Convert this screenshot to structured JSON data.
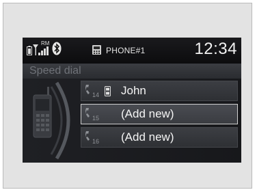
{
  "status_bar": {
    "icons": [
      "battery-icon",
      "signal-strength-icon",
      "roaming-indicator",
      "bluetooth-icon",
      "phone-icon"
    ],
    "roaming_label": "RM",
    "phone_label": "PHONE#1",
    "clock": "12:34"
  },
  "screen": {
    "title": "Speed dial"
  },
  "speed_dial": {
    "entries": [
      {
        "slot": "14",
        "label": "John",
        "icon": "mobile-phone-icon",
        "selected": false
      },
      {
        "slot": "15",
        "label": "(Add new)",
        "selected": true
      },
      {
        "slot": "16",
        "label": "(Add new)",
        "selected": false
      }
    ]
  },
  "colors": {
    "screen_bg": "#111114",
    "row_bg": "#34363b",
    "selection_border": "#d0d0d0",
    "text": "#f4f4f4",
    "title_text": "#6f7278"
  }
}
